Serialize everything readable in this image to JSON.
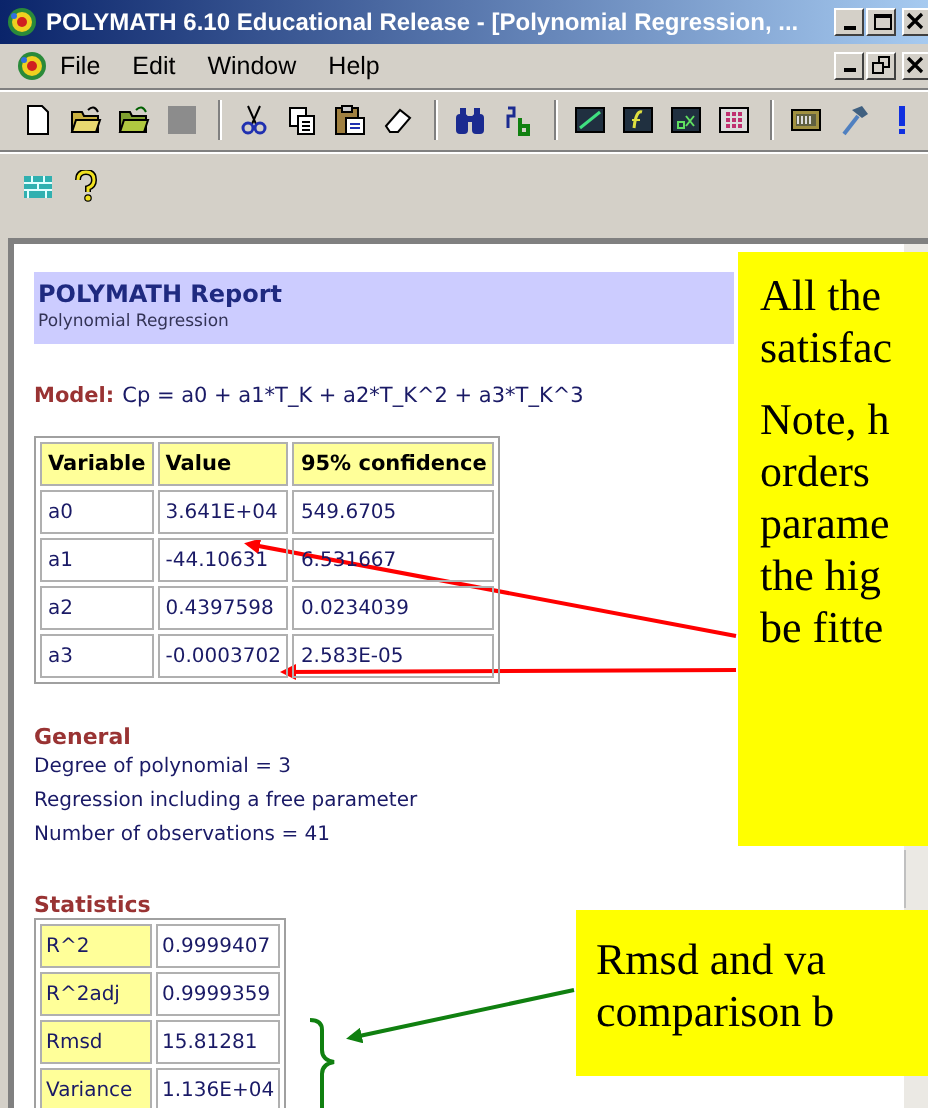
{
  "window": {
    "title": "POLYMATH 6.10 Educational Release - [Polynomial Regression, ..."
  },
  "menu": [
    "File",
    "Edit",
    "Window",
    "Help"
  ],
  "report": {
    "title": "POLYMATH Report",
    "subtitle": "Polynomial Regression",
    "model_label": "Model:",
    "model": "Cp = a0 + a1*T_K + a2*T_K^2 + a3*T_K^3",
    "table": {
      "columns": [
        "Variable",
        "Value",
        "95% confidence"
      ],
      "rows": [
        [
          "a0",
          "3.641E+04",
          "549.6705"
        ],
        [
          "a1",
          "-44.10631",
          "6.531667"
        ],
        [
          "a2",
          "0.4397598",
          "0.0234039"
        ],
        [
          "a3",
          "-0.0003702",
          "2.583E-05"
        ]
      ]
    },
    "general": {
      "heading": "General",
      "lines": [
        "Degree of polynomial = 3",
        "Regression including a free parameter",
        "Number of observations = 41"
      ]
    },
    "statistics": {
      "heading": "Statistics",
      "rows": [
        [
          "R^2",
          "0.9999407"
        ],
        [
          "R^2adj",
          "0.9999359"
        ],
        [
          "Rmsd",
          "15.81281"
        ],
        [
          "Variance",
          "1.136E+04"
        ]
      ]
    }
  },
  "callouts": [
    {
      "paragraphs": [
        [
          "All the",
          "satisfac"
        ],
        [
          "Note, h",
          "orders",
          "parame",
          "the hig",
          "be fitte"
        ]
      ]
    },
    {
      "paragraphs": [
        [
          "Rmsd and va",
          "comparison b"
        ]
      ]
    }
  ]
}
